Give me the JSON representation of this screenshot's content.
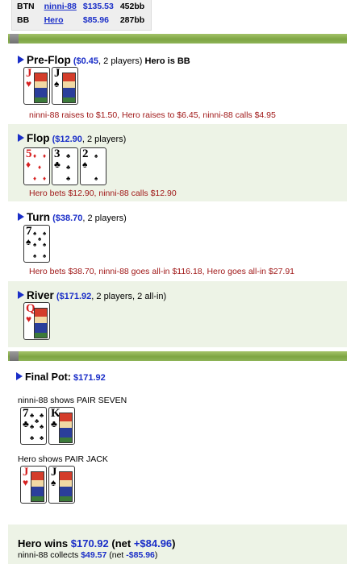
{
  "players": [
    {
      "position": "BTN",
      "name": "ninni-88",
      "stack": "$135.53",
      "bb": "452bb"
    },
    {
      "position": "BB",
      "name": "Hero",
      "stack": "$85.96",
      "bb": "287bb"
    }
  ],
  "colors": {
    "accent_green": "#8db357",
    "link_blue": "#1a2ec8",
    "action_red": "#a01818",
    "section_shade": "#edf3e6"
  },
  "preflop": {
    "street": "Pre-Flop",
    "pot": "($0.45",
    "info": ", 2 players)",
    "hero_info": "Hero is BB",
    "cards": [
      {
        "rank": "J",
        "suit": "♥",
        "color": "red",
        "face": true
      },
      {
        "rank": "J",
        "suit": "♠",
        "color": "black",
        "face": true
      }
    ],
    "action": "ninni-88 raises to $1.50, Hero raises to $6.45, ninni-88 calls $4.95"
  },
  "flop": {
    "street": "Flop",
    "pot": "($12.90",
    "info": ", 2 players)",
    "cards": [
      {
        "rank": "5",
        "suit": "♦",
        "color": "red"
      },
      {
        "rank": "3",
        "suit": "♣",
        "color": "black"
      },
      {
        "rank": "2",
        "suit": "♠",
        "color": "black"
      }
    ],
    "action": "Hero bets $12.90, ninni-88 calls $12.90"
  },
  "turn": {
    "street": "Turn",
    "pot": "($38.70",
    "info": ", 2 players)",
    "cards": [
      {
        "rank": "7",
        "suit": "♠",
        "color": "black"
      }
    ],
    "action": "Hero bets $38.70, ninni-88 goes all-in $116.18, Hero goes all-in $27.91"
  },
  "river": {
    "street": "River",
    "pot": "($171.92",
    "info": ", 2 players, 2 all-in)",
    "cards": [
      {
        "rank": "Q",
        "suit": "♥",
        "color": "red",
        "face": true
      }
    ]
  },
  "final": {
    "label": "Final Pot:",
    "pot": "$171.92",
    "showdowns": [
      {
        "text": "ninni-88 shows PAIR SEVEN",
        "cards": [
          {
            "rank": "7",
            "suit": "♣",
            "color": "black"
          },
          {
            "rank": "K",
            "suit": "♣",
            "color": "black",
            "face": true
          }
        ]
      },
      {
        "text": "Hero shows PAIR JACK",
        "cards": [
          {
            "rank": "J",
            "suit": "♥",
            "color": "red",
            "face": true
          },
          {
            "rank": "J",
            "suit": "♠",
            "color": "black",
            "face": true
          }
        ]
      }
    ]
  },
  "result": {
    "winner_prefix": "Hero wins ",
    "winner_amount": "$170.92",
    "winner_net_prefix": " (net ",
    "winner_net": "+$84.96",
    "winner_close": ")",
    "collects_prefix": "ninni-88 collects ",
    "collects_amount": "$49.57",
    "collects_net_prefix": " (net ",
    "collects_net": "-$85.96",
    "collects_close": ")"
  }
}
